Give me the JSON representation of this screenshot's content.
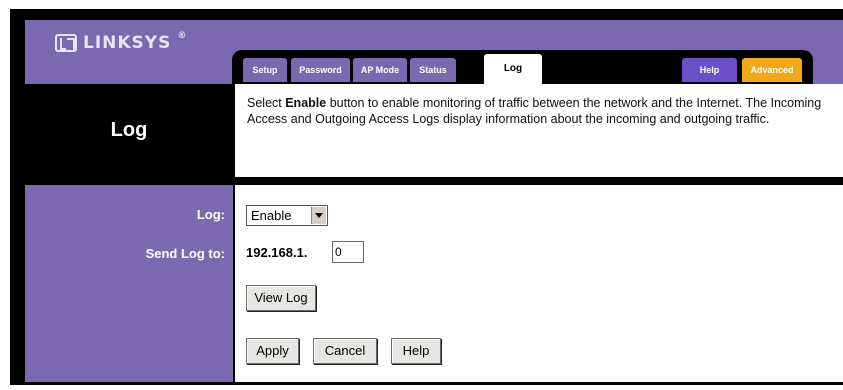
{
  "brand": {
    "name": "LINKSYS",
    "reg": "®"
  },
  "tabs": [
    {
      "label": "Setup"
    },
    {
      "label": "Password"
    },
    {
      "label": "AP Mode"
    },
    {
      "label": "Status"
    },
    {
      "label": "Log",
      "active": true
    },
    {
      "label": "Help"
    },
    {
      "label": "Advanced"
    }
  ],
  "page": {
    "title": "Log",
    "description": {
      "pre": "Select ",
      "bold": "Enable",
      "post": " button to enable monitoring of traffic between the network and the Internet. The Incoming Access and Outgoing Access Logs display information about the incoming and outgoing traffic."
    }
  },
  "form": {
    "log_label": "Log:",
    "log_value": "Enable",
    "log_options": [
      "Enable"
    ],
    "send_label": "Send Log to:",
    "ip_prefix": "192.168.1.",
    "ip_last_octet": "0"
  },
  "buttons": {
    "view_log": "View Log",
    "apply": "Apply",
    "cancel": "Cancel",
    "help": "Help"
  },
  "colors": {
    "purple": "#7a68b0",
    "help_tab": "#6a50c8",
    "advanced_tab": "#f2a818"
  }
}
